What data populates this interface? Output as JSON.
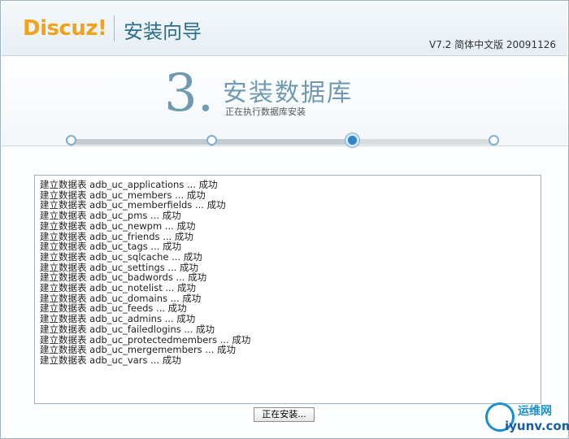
{
  "header": {
    "logo_text": "Discuz!",
    "wizard_title": "安装向导",
    "version": "V7.2 简体中文版 20091126"
  },
  "step": {
    "number": "3.",
    "title": "安装数据库",
    "subtitle": "正在执行数据库安装",
    "current": 3,
    "total": 4
  },
  "log": {
    "lines": [
      "建立数据表 adb_uc_applications ... 成功",
      "建立数据表 adb_uc_members ... 成功",
      "建立数据表 adb_uc_memberfields ... 成功",
      "建立数据表 adb_uc_pms ... 成功",
      "建立数据表 adb_uc_newpm ... 成功",
      "建立数据表 adb_uc_friends ... 成功",
      "建立数据表 adb_uc_tags ... 成功",
      "建立数据表 adb_uc_sqlcache ... 成功",
      "建立数据表 adb_uc_settings ... 成功",
      "建立数据表 adb_uc_badwords ... 成功",
      "建立数据表 adb_uc_notelist ... 成功",
      "建立数据表 adb_uc_domains ... 成功",
      "建立数据表 adb_uc_feeds ... 成功",
      "建立数据表 adb_uc_admins ... 成功",
      "建立数据表 adb_uc_failedlogins ... 成功",
      "建立数据表 adb_uc_protectedmembers ... 成功",
      "建立数据表 adb_uc_mergemembers ... 成功",
      "建立数据表 adb_uc_vars ... 成功"
    ]
  },
  "actions": {
    "install_button": "正在安装..."
  },
  "watermark": {
    "cn": "运维网",
    "en": "iyunv.com"
  },
  "colors": {
    "logo": "#f0a31a",
    "title": "#2c6e8e",
    "step_accent": "#6f9ab2",
    "active_dot": "#2f86c6"
  }
}
